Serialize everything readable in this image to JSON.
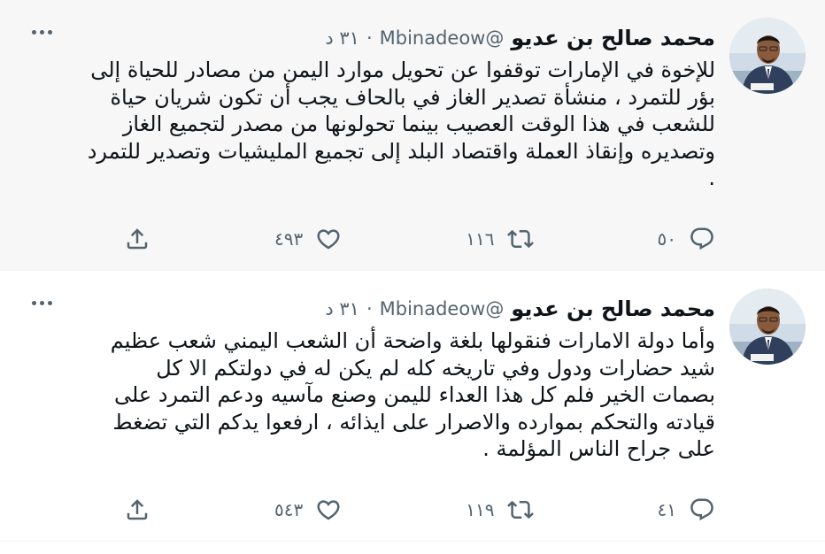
{
  "tweets": [
    {
      "name": "محمد صالح بن عديو",
      "handle": "@Mbinadeow",
      "separator": "·",
      "time": "٣١ د",
      "text": "للإخوة في الإمارات توقفوا عن تحويل موارد اليمن من مصادر للحياة إلى\nبؤر للتمرد ، منشأة تصدير الغاز في بالحاف  يجب أن تكون شريان حياة\nللشعب في هذا الوقت العصيب بينما  تحولونها  من مصدر لتجميع الغاز\nوتصديره وإنقاذ العملة واقتصاد البلد إلى تجميع المليشيات وتصدير للتمرد\n.",
      "replies": "٥٠",
      "retweets": "١١٦",
      "likes": "٤٩٣"
    },
    {
      "name": "محمد صالح بن عديو",
      "handle": "@Mbinadeow",
      "separator": "·",
      "time": "٣١ د",
      "text": "وأما دولة الامارات فنقولها بلغة واضحة أن الشعب اليمني شعب عظيم\nشيد حضارات ودول وفي تاريخه كله  لم يكن له في دولتكم الا كل\nبصمات الخير فلم كل هذا العداء لليمن وصنع مآسيه ودعم التمرد على\nقيادته والتحكم بموارده والاصرار على ايذائه ، ارفعوا يدكم التي تضغط\nعلى جراح الناس المؤلمة .",
      "replies": "٤١",
      "retweets": "١١٩",
      "likes": "٥٤٣"
    }
  ],
  "icons": {
    "reply": "reply-icon",
    "retweet": "retweet-icon",
    "like": "heart-icon",
    "share": "share-icon",
    "more": "more-icon"
  },
  "colors": {
    "text": "#0f1419",
    "secondary": "#536471",
    "highlight_background": "#f7f7f7"
  }
}
